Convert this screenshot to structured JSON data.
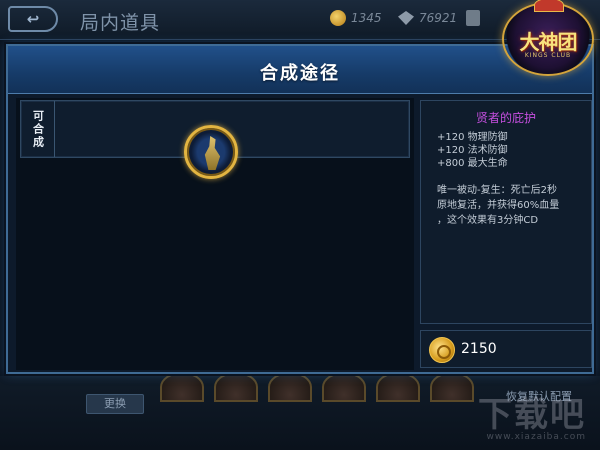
{
  "background": {
    "title": "局内道具",
    "back_icon": "↩",
    "gold_amount": "1345",
    "diamond_amount": "76921",
    "swap_button": "更换",
    "default_button": "恢复默认配置",
    "logo": {
      "text": "大神团",
      "subtitle": "KINGS CLUB"
    },
    "watermark": {
      "main": "下载吧",
      "sub": "www.xiazaiba.com"
    }
  },
  "dialog": {
    "title": "合成途径",
    "compose_label": "可合成",
    "item": {
      "name": "贤者的庇护",
      "icon": "sage-protection-item-icon",
      "stats": [
        "+120 物理防御",
        "+120 法术防御",
        "+800 最大生命"
      ],
      "passive": [
        "唯一被动-复生：死亡后2秒",
        "原地复活，并获得60%血量",
        "，这个效果有3分钟CD"
      ],
      "price": "2150"
    }
  },
  "colors": {
    "header_blue": "#1e4b80",
    "item_name": "#c64fe0",
    "gold": "#e3b541"
  }
}
